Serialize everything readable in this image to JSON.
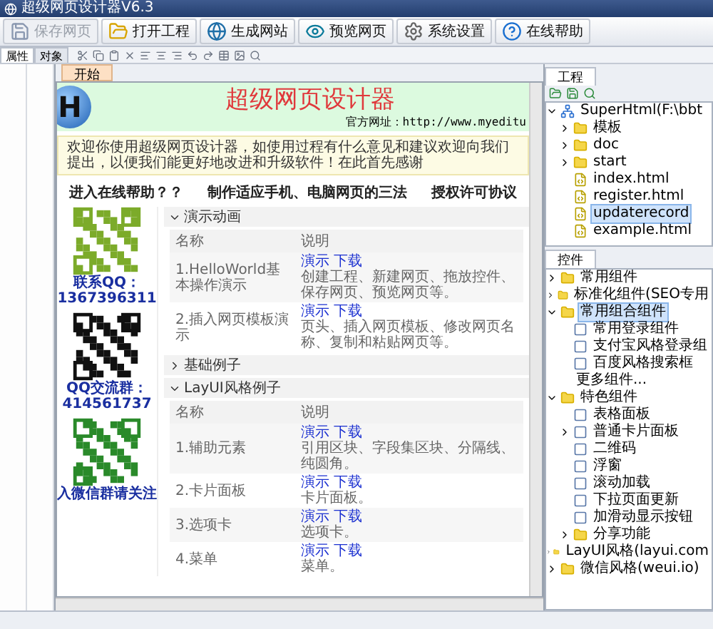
{
  "window": {
    "title": "超级网页设计器V6.3"
  },
  "toolbar": [
    {
      "label": "保存网页",
      "disabled": true
    },
    {
      "label": "打开工程",
      "disabled": false
    },
    {
      "label": "生成网站",
      "disabled": false
    },
    {
      "label": "预览网页",
      "disabled": false
    },
    {
      "label": "系统设置",
      "disabled": false
    },
    {
      "label": "在线帮助",
      "disabled": false
    }
  ],
  "left_tabs": [
    {
      "label": "属性",
      "selected": true
    },
    {
      "label": "对象",
      "selected": false
    }
  ],
  "document_tabs": [
    {
      "label": "开始",
      "selected": true
    }
  ],
  "page": {
    "logo": "H",
    "title": "超级网页设计器",
    "site": "官方网址：http://www.myeditu",
    "notice": "欢迎你使用超级网页设计器，如使用过程有什么意见和建议欢迎向我们提出，以便我们能更好地改进和升级软件！在此首先感谢",
    "links": [
      "进入在线帮助？？",
      "制作适应手机、电脑网页的三法",
      "授权许可协议"
    ],
    "contacts": [
      {
        "caption": "联系QQ：1367396311"
      },
      {
        "caption": "QQ交流群：414561737"
      },
      {
        "caption": "入微信群请关注"
      }
    ],
    "sections": [
      {
        "title": "演示动画",
        "expanded": true,
        "columns": [
          "名称",
          "说明"
        ],
        "rows": [
          {
            "name": "1.HelloWorld基本操作演示",
            "actions": [
              "演示",
              "下载"
            ],
            "desc": "创建工程、新建网页、拖放控件、保存网页、预览网页等。"
          },
          {
            "name": "2.插入网页模板演示",
            "actions": [
              "演示",
              "下载"
            ],
            "desc": "页头、插入网页模板、修改网页名称、复制和粘贴网页等。"
          }
        ]
      },
      {
        "title": "基础例子",
        "expanded": false
      },
      {
        "title": "LayUI风格例子",
        "expanded": true,
        "columns": [
          "名称",
          "说明"
        ],
        "rows": [
          {
            "name": "1.辅助元素",
            "actions": [
              "演示",
              "下载"
            ],
            "desc": "引用区块、字段集区块、分隔线、纯圆角。"
          },
          {
            "name": "2.卡片面板",
            "actions": [
              "演示",
              "下载"
            ],
            "desc": "卡片面板。"
          },
          {
            "name": "3.选项卡",
            "actions": [
              "演示",
              "下载"
            ],
            "desc": "选项卡。"
          },
          {
            "name": "4.菜单",
            "actions": [
              "演示",
              "下载"
            ],
            "desc": "菜单。"
          }
        ]
      }
    ]
  },
  "project_panel": {
    "tab": "工程",
    "tree": [
      {
        "label": "SuperHtml(F:\\bbt",
        "kind": "project",
        "expanded": true,
        "selected": false,
        "children": [
          {
            "label": "模板",
            "kind": "folder",
            "expanded": false,
            "selected": false
          },
          {
            "label": "doc",
            "kind": "folder",
            "expanded": false,
            "selected": false
          },
          {
            "label": "start",
            "kind": "folder",
            "expanded": false,
            "selected": false
          },
          {
            "label": "index.html",
            "kind": "file",
            "selected": false
          },
          {
            "label": "register.html",
            "kind": "file",
            "selected": false
          },
          {
            "label": "updaterecord",
            "kind": "file",
            "selected": true
          },
          {
            "label": "example.html",
            "kind": "file",
            "selected": false
          }
        ]
      }
    ]
  },
  "components_panel": {
    "tab": "控件",
    "tree": [
      {
        "label": "常用组件",
        "kind": "folder",
        "expanded": false,
        "selected": false
      },
      {
        "label": "标准化组件(SEO专用",
        "kind": "folder",
        "expanded": false,
        "selected": false
      },
      {
        "label": "常用组合组件",
        "kind": "folder",
        "expanded": true,
        "selected": true,
        "children": [
          {
            "label": "常用登录组件",
            "kind": "component",
            "selected": false
          },
          {
            "label": "支付宝风格登录组",
            "kind": "component",
            "selected": false
          },
          {
            "label": "百度风格搜索框",
            "kind": "component",
            "selected": false
          },
          {
            "label": "更多组件...",
            "kind": "plain",
            "selected": false
          }
        ]
      },
      {
        "label": "特色组件",
        "kind": "folder",
        "expanded": true,
        "selected": false,
        "children": [
          {
            "label": "表格面板",
            "kind": "component",
            "selected": false
          },
          {
            "label": "普通卡片面板",
            "kind": "component",
            "expanded": false,
            "selected": false
          },
          {
            "label": "二维码",
            "kind": "component",
            "selected": false
          },
          {
            "label": "浮窗",
            "kind": "component",
            "selected": false
          },
          {
            "label": "滚动加载",
            "kind": "component",
            "selected": false
          },
          {
            "label": "下拉页面更新",
            "kind": "component",
            "selected": false
          },
          {
            "label": "加滑动显示按钮",
            "kind": "component",
            "selected": false
          },
          {
            "label": "分享功能",
            "kind": "folder",
            "expanded": false,
            "selected": false
          }
        ]
      },
      {
        "label": "LayUI风格(layui.com",
        "kind": "folder",
        "expanded": false,
        "selected": false
      },
      {
        "label": "微信风格(weui.io)",
        "kind": "folder",
        "expanded": false,
        "selected": false
      }
    ]
  }
}
